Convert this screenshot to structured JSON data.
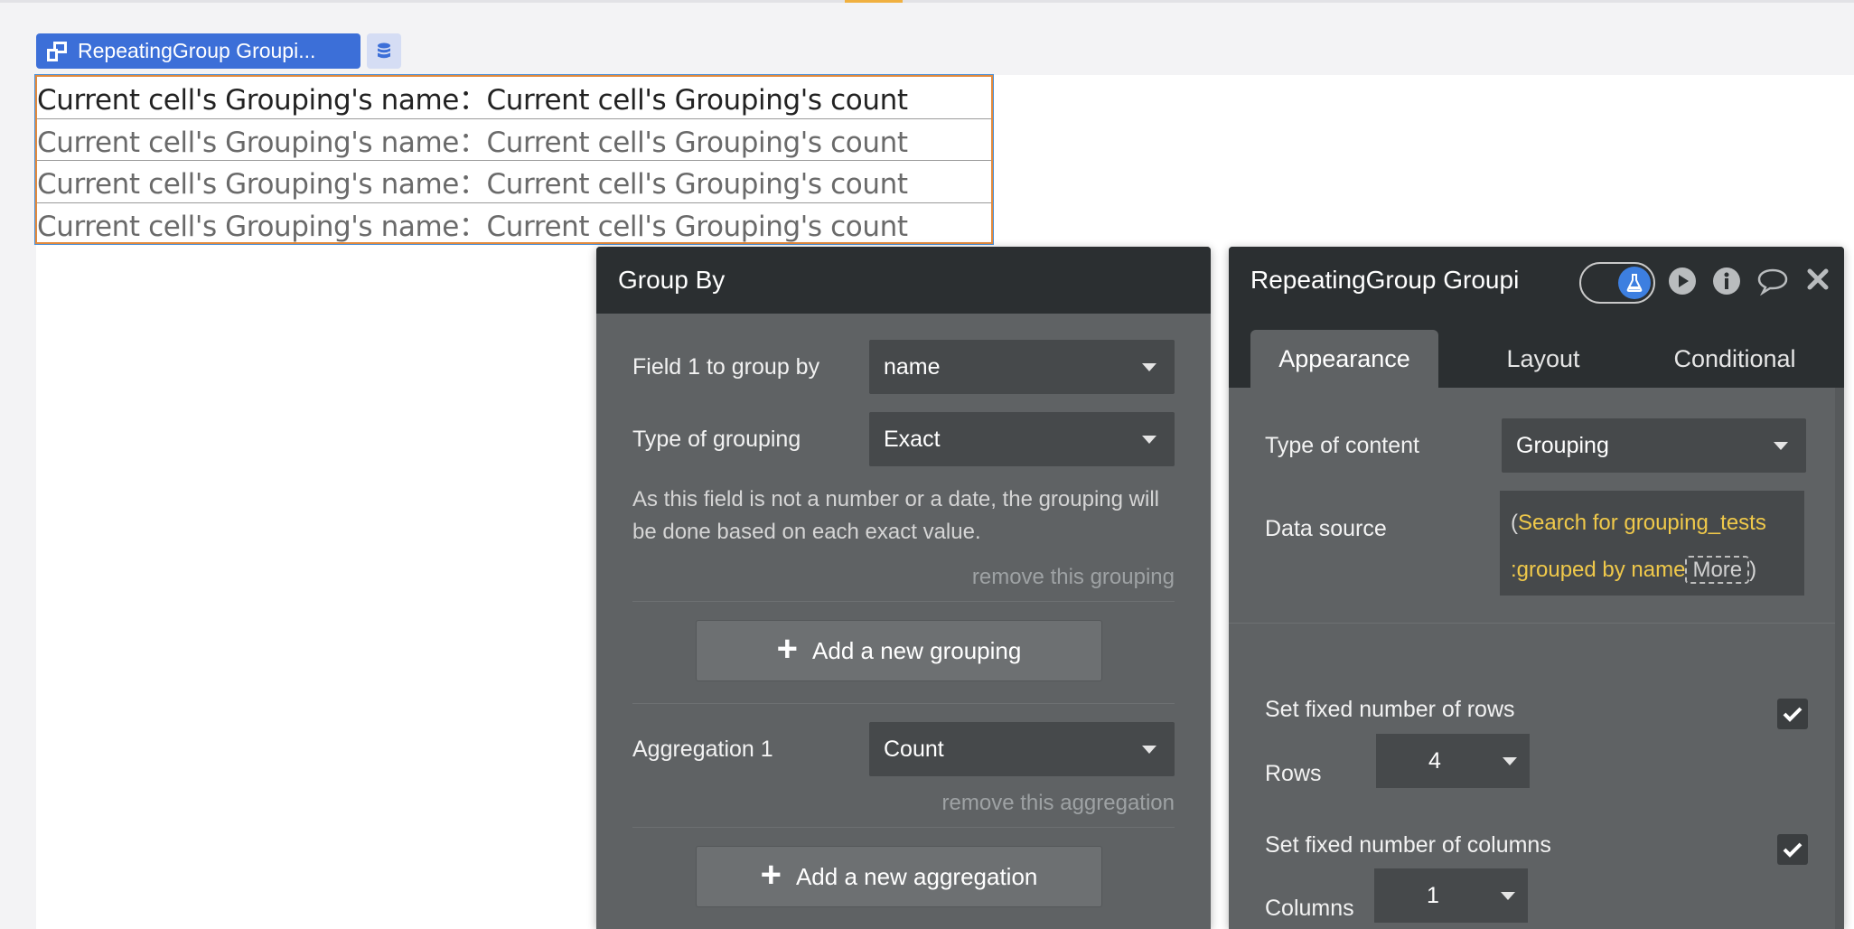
{
  "element_tag": {
    "label": "RepeatingGroup Groupi...",
    "icon": "repeating-group-icon",
    "db_icon": "database-icon"
  },
  "repeating_group": {
    "rows": [
      "Current cell's Grouping's name：Current cell's Grouping's count",
      "Current cell's Grouping's name：Current cell's Grouping's count",
      "Current cell's Grouping's name：Current cell's Grouping's count",
      "Current cell's Grouping's name：Current cell's Grouping's count"
    ]
  },
  "group_by": {
    "title": "Group By",
    "field1_label": "Field 1 to group by",
    "field1_value": "name",
    "type_label": "Type of grouping",
    "type_value": "Exact",
    "hint": "As this field is not a number or a date, the grouping will be done based on each exact value.",
    "remove_grouping": "remove this grouping",
    "add_grouping": "Add a new grouping",
    "agg_label": "Aggregation 1",
    "agg_value": "Count",
    "remove_aggregation": "remove this aggregation",
    "add_aggregation": "Add a new aggregation"
  },
  "property_editor": {
    "title": "RepeatingGroup Groupi",
    "tabs": [
      "Appearance",
      "Layout",
      "Conditional"
    ],
    "active_tab": "Appearance",
    "type_of_content_label": "Type of content",
    "type_of_content_value": "Grouping",
    "data_source_label": "Data source",
    "data_source_open": "(",
    "data_source_line1": "Search for grouping_tests",
    "data_source_line2": ":grouped by name",
    "data_source_more": "More",
    "data_source_close": ")",
    "fixed_rows_label": "Set fixed number of rows",
    "fixed_rows_checked": true,
    "rows_label": "Rows",
    "rows_value": "4",
    "fixed_cols_label": "Set fixed number of columns",
    "fixed_cols_checked": true,
    "columns_label": "Columns",
    "columns_value": "1"
  },
  "colors": {
    "accent": "#3c6fd8",
    "data_source_text": "#f0c94a",
    "selection_border": "#e28a3d"
  }
}
